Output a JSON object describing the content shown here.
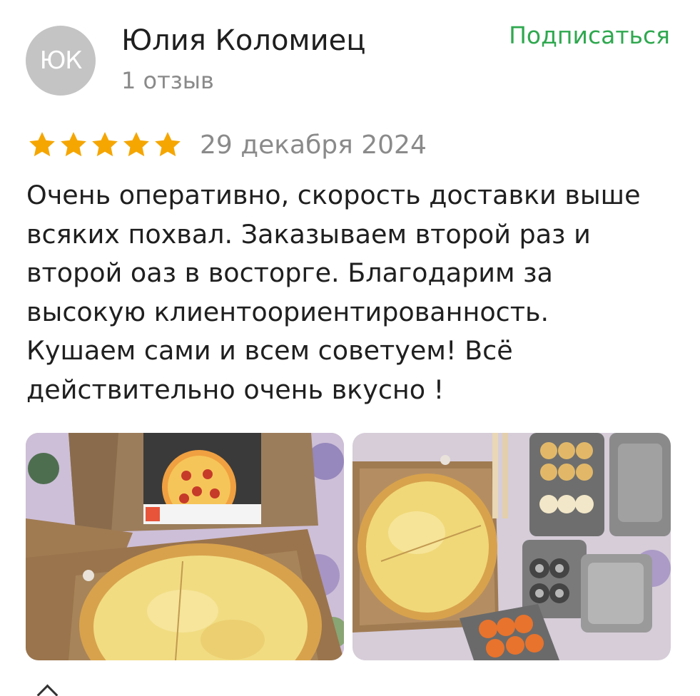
{
  "author": {
    "initials": "ЮК",
    "name": "Юлия Коломиец",
    "reviews_count": "1 отзыв"
  },
  "subscribe_label": "Подписаться",
  "review": {
    "rating": 5,
    "max_rating": 5,
    "date": "29 декабря 2024",
    "text": "Очень оперативно, скорость доставки выше\nвсяких похвал. Заказываем второй раз и\nвторой оаз в восторге. Благодарим за\nвысокую клиентоориентированность.\nКушаем сами и всем советуем! Всё\nдействительно очень вкусно !"
  },
  "photos": [
    {
      "icon": "pizza-box-photo"
    },
    {
      "icon": "pizza-and-rolls-photo"
    }
  ],
  "colors": {
    "accent": "#2fa84f",
    "star": "#f5a600",
    "text": "#1f1f1f",
    "muted": "#8a8a8a",
    "avatar_bg": "#c4c4c4"
  }
}
